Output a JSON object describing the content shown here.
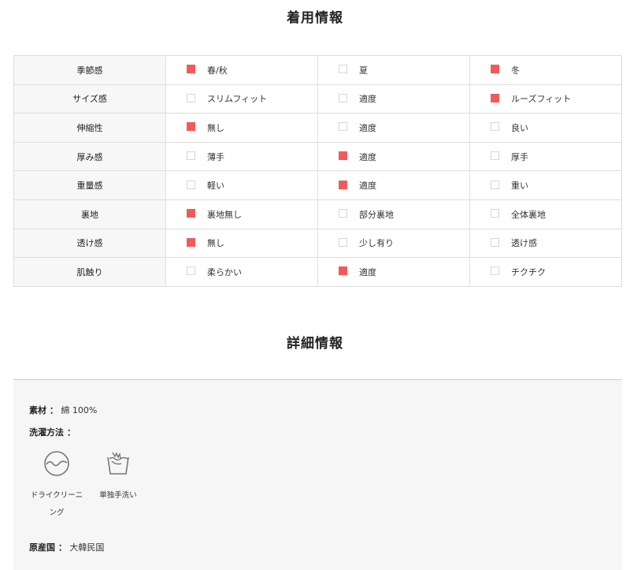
{
  "wearing_info": {
    "title": "着用情報",
    "rows": [
      {
        "label": "季節感",
        "options": [
          {
            "text": "春/秋",
            "checked": true
          },
          {
            "text": "夏",
            "checked": false
          },
          {
            "text": "冬",
            "checked": true
          }
        ]
      },
      {
        "label": "サイズ感",
        "options": [
          {
            "text": "スリムフィット",
            "checked": false
          },
          {
            "text": "適度",
            "checked": false
          },
          {
            "text": "ルーズフィット",
            "checked": true
          }
        ]
      },
      {
        "label": "伸縮性",
        "options": [
          {
            "text": "無し",
            "checked": true
          },
          {
            "text": "適度",
            "checked": false
          },
          {
            "text": "良い",
            "checked": false
          }
        ]
      },
      {
        "label": "厚み感",
        "options": [
          {
            "text": "薄手",
            "checked": false
          },
          {
            "text": "適度",
            "checked": true
          },
          {
            "text": "厚手",
            "checked": false
          }
        ]
      },
      {
        "label": "重量感",
        "options": [
          {
            "text": "軽い",
            "checked": false
          },
          {
            "text": "適度",
            "checked": true
          },
          {
            "text": "重い",
            "checked": false
          }
        ]
      },
      {
        "label": "裏地",
        "options": [
          {
            "text": "裏地無し",
            "checked": true
          },
          {
            "text": "部分裏地",
            "checked": false
          },
          {
            "text": "全体裏地",
            "checked": false
          }
        ]
      },
      {
        "label": "透け感",
        "options": [
          {
            "text": "無し",
            "checked": true
          },
          {
            "text": "少し有り",
            "checked": false
          },
          {
            "text": "透け感",
            "checked": false
          }
        ]
      },
      {
        "label": "肌触り",
        "options": [
          {
            "text": "柔らかい",
            "checked": false
          },
          {
            "text": "適度",
            "checked": true
          },
          {
            "text": "チクチク",
            "checked": false
          }
        ]
      }
    ],
    "check_color": "#f25a5a"
  },
  "detail_info": {
    "title": "詳細情報",
    "material_label": "素材 ：",
    "material_value": "綿 100%",
    "wash_label": "洗濯方法 ：",
    "wash_methods": [
      {
        "icon": "dry-clean-icon",
        "label_line1": "ドライクリーニ",
        "label_line2": "ング"
      },
      {
        "icon": "hand-wash-icon",
        "label_line1": "単独手洗い",
        "label_line2": ""
      }
    ],
    "origin_label": "原産国 ：",
    "origin_value": "大韓民国"
  }
}
